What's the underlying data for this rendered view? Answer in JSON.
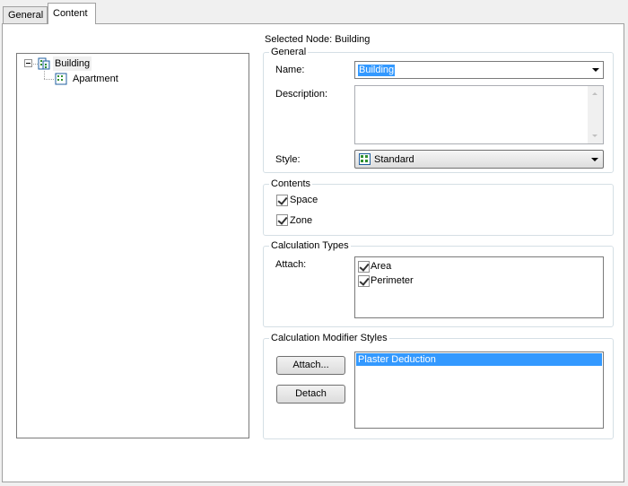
{
  "tabs": [
    {
      "label": "General",
      "active": false
    },
    {
      "label": "Content",
      "active": true
    }
  ],
  "tree": {
    "root": {
      "label": "Building",
      "icon": "building-icon",
      "expanded": true
    },
    "children": [
      {
        "label": "Apartment",
        "icon": "apartment-icon"
      }
    ]
  },
  "selected_node": {
    "label": "Selected Node: Building"
  },
  "general_group": {
    "title": "General",
    "name_label": "Name:",
    "name_value": "Building",
    "description_label": "Description:",
    "description_value": "",
    "style_label": "Style:",
    "style_value": "Standard"
  },
  "contents_group": {
    "title": "Contents",
    "items": [
      {
        "label": "Space",
        "checked": true
      },
      {
        "label": "Zone",
        "checked": true
      }
    ]
  },
  "calc_types_group": {
    "title": "Calculation Types",
    "attach_label": "Attach:",
    "items": [
      {
        "label": "Area",
        "checked": true
      },
      {
        "label": "Perimeter",
        "checked": true
      }
    ]
  },
  "calc_modifier_group": {
    "title": "Calculation Modifier Styles",
    "attach_button": "Attach...",
    "detach_button": "Detach",
    "items": [
      {
        "label": "Plaster Deduction",
        "selected": true
      }
    ]
  },
  "colors": {
    "selection": "#3399ff",
    "group_border": "#d5dfe5"
  }
}
